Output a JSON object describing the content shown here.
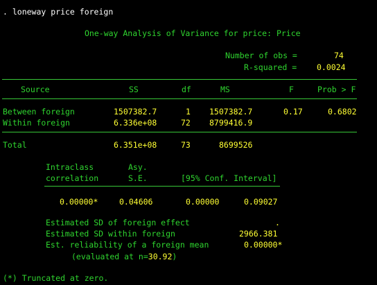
{
  "command": ". loneway price foreign",
  "title": "One-way Analysis of Variance for price: Price",
  "stats": {
    "nobs_label": "Number of obs =",
    "nobs_value": "74",
    "r2_label": "R-squared =",
    "r2_value": "0.0024"
  },
  "table": {
    "headers": [
      "Source",
      "SS",
      "df",
      "MS",
      "F",
      "Prob > F"
    ],
    "rows": [
      {
        "source": "Between foreign",
        "ss": "1507382.7",
        "df": "1",
        "ms": "1507382.7",
        "f": "0.17",
        "p": "0.6802"
      },
      {
        "source": "Within foreign",
        "ss": "6.336e+08",
        "df": "72",
        "ms": "8799416.9",
        "f": "",
        "p": ""
      }
    ],
    "total": {
      "source": "Total",
      "ss": "6.351e+08",
      "df": "73",
      "ms": "8699526"
    }
  },
  "icc": {
    "header1": [
      "Intraclass",
      "Asy."
    ],
    "header2": [
      "correlation",
      "S.E.",
      "[95% Conf. Interval]"
    ],
    "values": [
      "0.00000*",
      "0.04606",
      "0.00000",
      "0.09027"
    ]
  },
  "estimates": [
    {
      "label": "Estimated SD of foreign effect",
      "value": "."
    },
    {
      "label": "Estimated SD within foreign",
      "value": "2966.381"
    },
    {
      "label": "Est. reliability of a foreign mean",
      "value": "0.00000*"
    }
  ],
  "evaluated": {
    "prefix": "(evaluated at n=",
    "n": "30.92",
    "suffix": ")"
  },
  "footnote": "(*) Truncated at zero."
}
